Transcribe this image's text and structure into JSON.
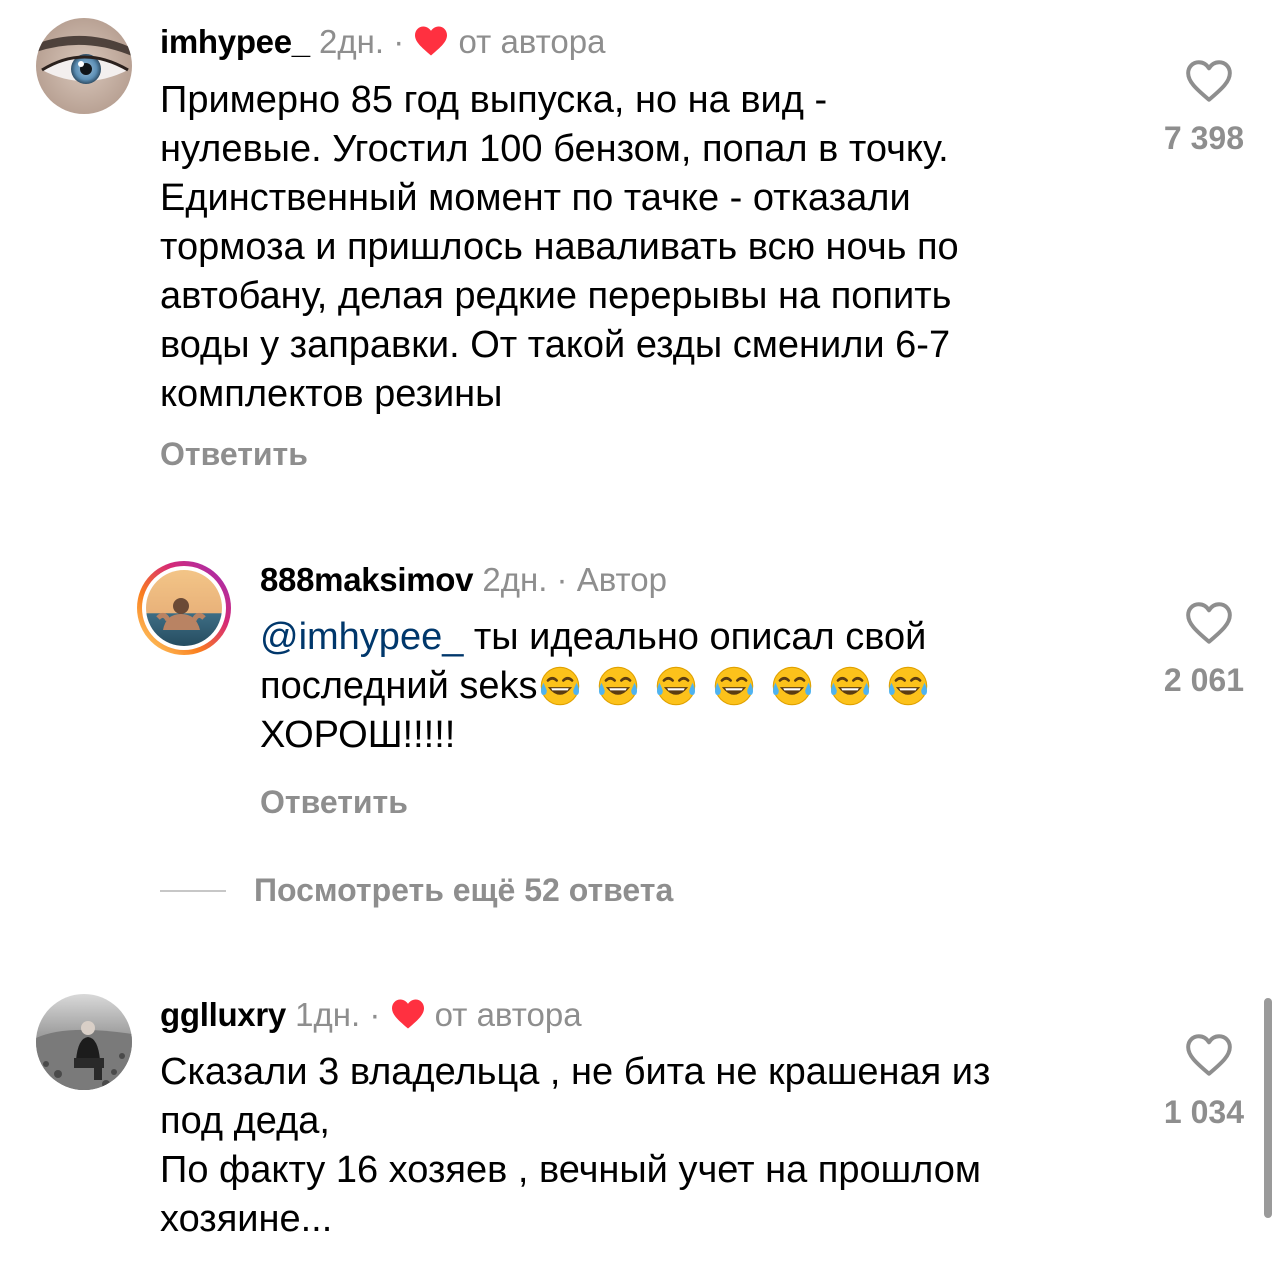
{
  "comments": [
    {
      "username": "imhypee_",
      "time": "2дн.",
      "separator": "·",
      "badge": "от автора",
      "text": "Примерно 85 год выпуска, но на вид -\nнулевые. Угостил 100 бензом, попал в точку.\nЕдинственный момент по тачке - отказали\nтормоза и пришлось наваливать всю ночь по\nавтобану, делая редкие перерывы на попить\nводы у заправки. От такой езды сменили 6-7\nкомплектов резины",
      "reply_label": "Ответить",
      "likes": "7 398"
    },
    {
      "username": "888maksimov",
      "time": "2дн.",
      "separator": "·",
      "badge": "Автор",
      "mention": "@imhypee_",
      "text_line1": " ты идеально описал свой",
      "text_line2": "последний seks",
      "text_line3": "ХОРОШ!!!!!",
      "emoji": "face-with-tears-of-joy",
      "emoji_count": 7,
      "reply_label": "Ответить",
      "likes": "2 061"
    },
    {
      "username": "gglluxry",
      "time": "1дн.",
      "separator": "·",
      "badge": "от автора",
      "text": "Сказали 3  владельца , не бита не крашеная из\nпод деда,\nПо факту 16 хозяев , вечный учет на прошлом\nхозяине...",
      "likes": "1 034"
    }
  ],
  "view_more_replies": "Посмотреть ещё 52 ответа",
  "colors": {
    "secondary_text": "#8e8e8e",
    "mention": "#00376b",
    "heart_red": "#ff3040",
    "story_ring": [
      "#feda75",
      "#fa7e1e",
      "#d62976",
      "#962fbf"
    ]
  },
  "icons": {
    "like": "heart-outline-icon",
    "creator_like": "heart-filled-icon"
  }
}
